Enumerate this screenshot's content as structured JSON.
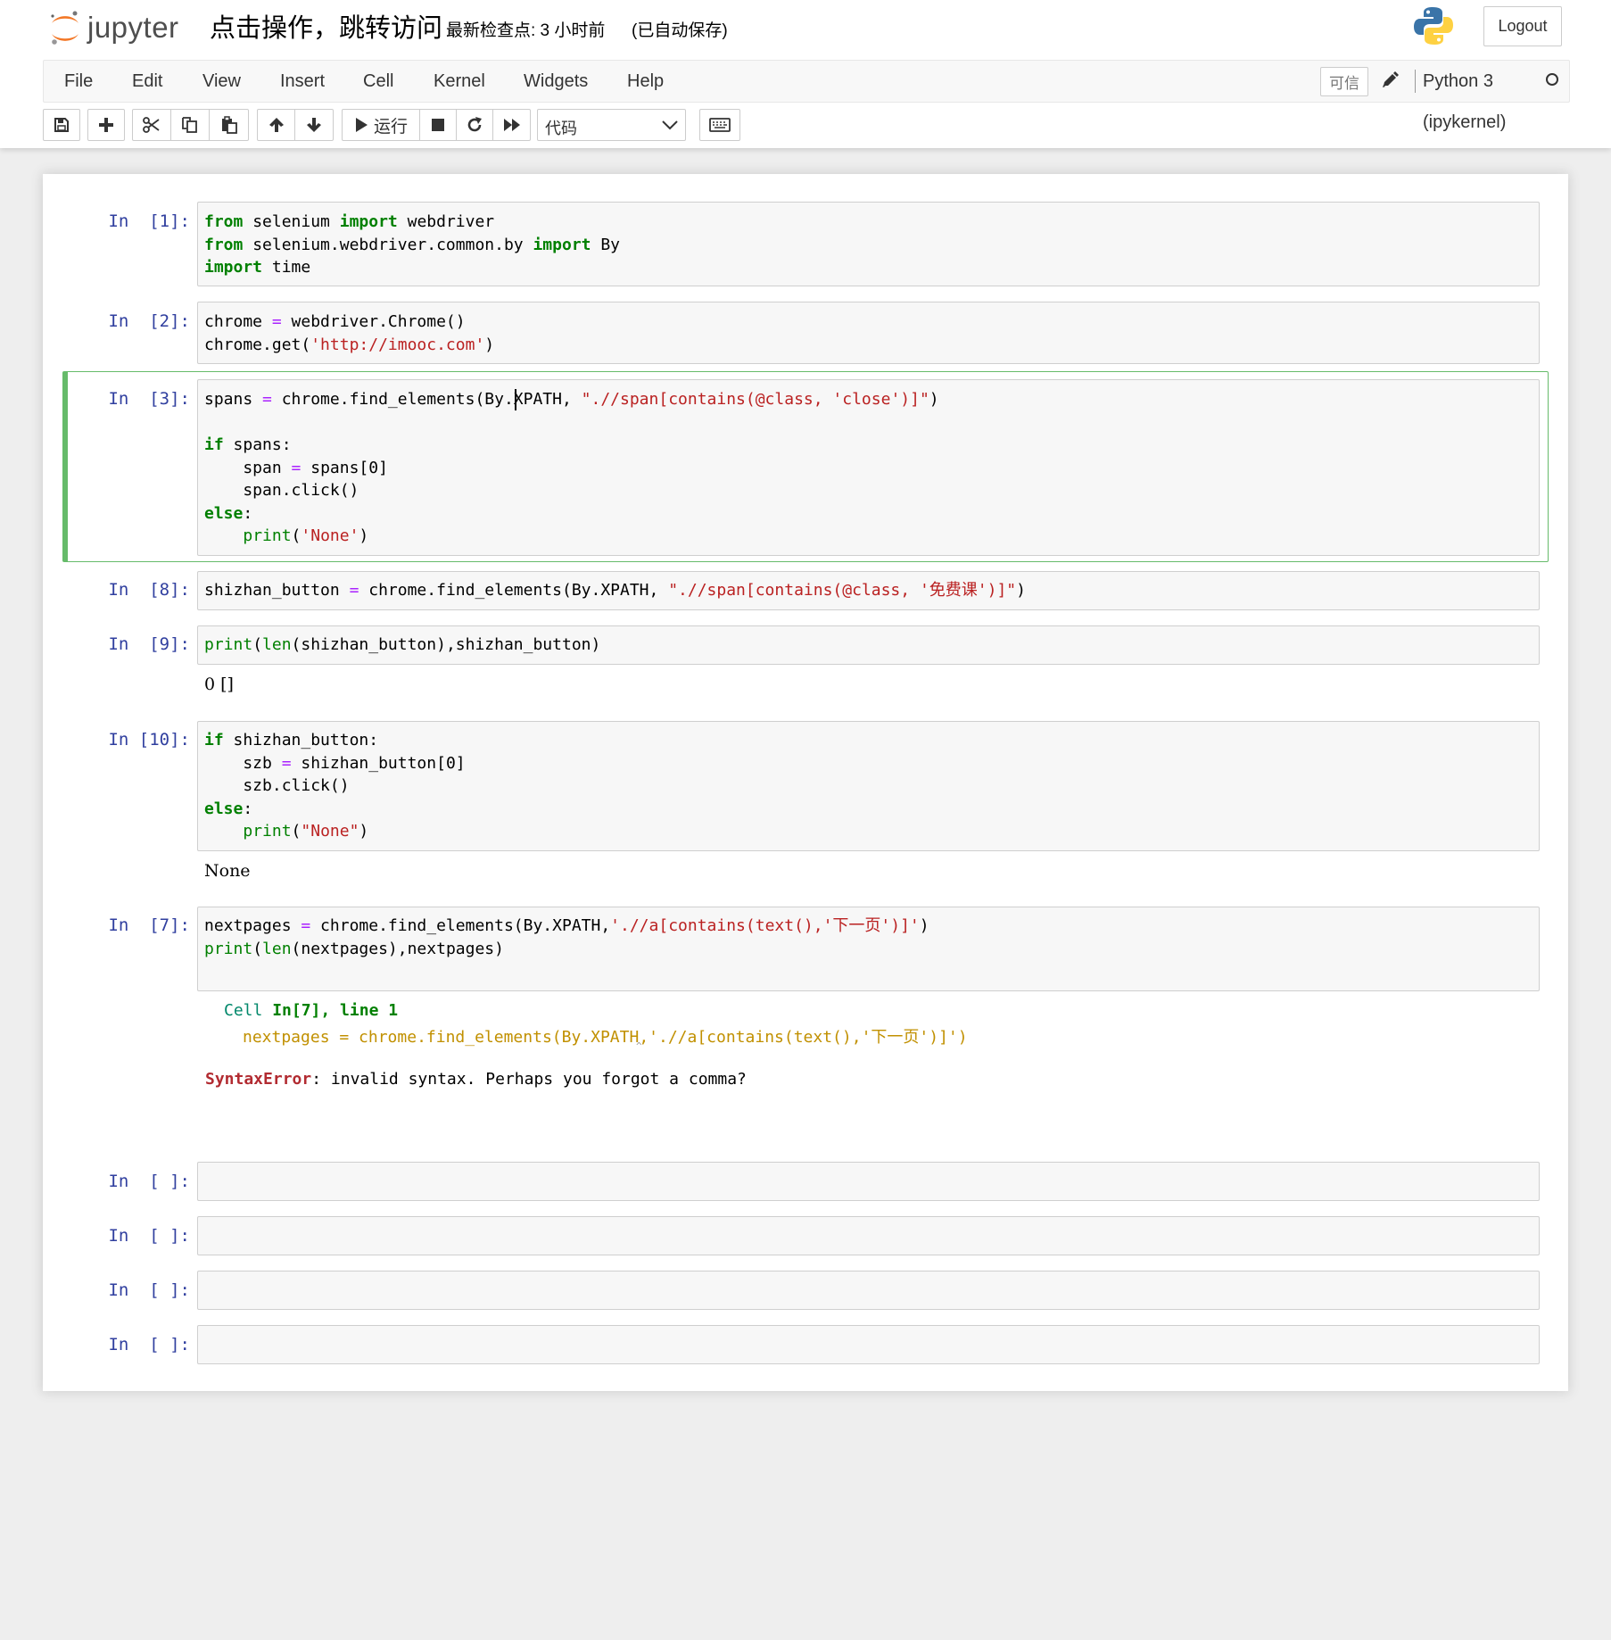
{
  "header": {
    "logo_text": "jupyter",
    "notebook_title": "点击操作，跳转访问",
    "checkpoint": "最新检查点: 3 小时前",
    "autosave": "(已自动保存)",
    "logout_label": "Logout"
  },
  "menubar": {
    "items": [
      "File",
      "Edit",
      "View",
      "Insert",
      "Cell",
      "Kernel",
      "Widgets",
      "Help"
    ],
    "trusted_label": "可信",
    "kernel_name": "Python 3 (ipykernel)"
  },
  "toolbar": {
    "run_label": "运行",
    "cell_type": "代码",
    "icons": [
      "save-icon",
      "plus-icon",
      "scissors-icon",
      "copy-icon",
      "paste-icon",
      "arrow-up-icon",
      "arrow-down-icon",
      "play-icon",
      "stop-icon",
      "restart-icon",
      "fast-forward-icon",
      "keyboard-icon"
    ]
  },
  "cells": [
    {
      "prompt": "In  [1]:",
      "lines": [
        [
          [
            "kw",
            "from"
          ],
          [
            "",
            " selenium "
          ],
          [
            "kw",
            "import"
          ],
          [
            "",
            " webdriver"
          ]
        ],
        [
          [
            "kw",
            "from"
          ],
          [
            "",
            " selenium.webdriver.common.by "
          ],
          [
            "kw",
            "import"
          ],
          [
            "",
            " By"
          ]
        ],
        [
          [
            "kw",
            "import"
          ],
          [
            "",
            " time"
          ]
        ]
      ]
    },
    {
      "prompt": "In  [2]:",
      "lines": [
        [
          [
            "",
            "chrome "
          ],
          [
            "op",
            "="
          ],
          [
            "",
            " webdriver.Chrome()"
          ]
        ],
        [
          [
            "",
            "chrome.get("
          ],
          [
            "str",
            "'http://imooc.com'"
          ],
          [
            "",
            ")"
          ]
        ]
      ]
    },
    {
      "prompt": "In  [3]:",
      "lines": [
        [
          [
            "",
            "spans "
          ],
          [
            "op",
            "="
          ],
          [
            "",
            " chrome.find_elements(By.XPATH, "
          ],
          [
            "str",
            "\".//span[contains(@class, 'close')]\""
          ],
          [
            "",
            ")"
          ]
        ],
        [],
        [
          [
            "kw",
            "if"
          ],
          [
            "",
            " spans:"
          ]
        ],
        [
          [
            "",
            "    span "
          ],
          [
            "op",
            "="
          ],
          [
            "",
            " spans[0]"
          ]
        ],
        [
          [
            "",
            "    span.click()"
          ]
        ],
        [
          [
            "kw",
            "else"
          ],
          [
            "",
            ":"
          ]
        ],
        [
          [
            "",
            "    "
          ],
          [
            "bi",
            "print"
          ],
          [
            "",
            "("
          ],
          [
            "str",
            "'None'"
          ],
          [
            "",
            ")"
          ]
        ]
      ]
    },
    {
      "prompt": "In  [8]:",
      "lines": [
        [
          [
            "",
            "shizhan_button "
          ],
          [
            "op",
            "="
          ],
          [
            "",
            " chrome.find_elements(By.XPATH, "
          ],
          [
            "str",
            "\".//span[contains(@class, '免费课')]\""
          ],
          [
            "",
            ")"
          ]
        ]
      ]
    },
    {
      "prompt": "In  [9]:",
      "lines": [
        [
          [
            "bi",
            "print"
          ],
          [
            "",
            "("
          ],
          [
            "bi",
            "len"
          ],
          [
            "",
            "(shizhan_button),shizhan_button)"
          ]
        ]
      ],
      "output": "0 []"
    },
    {
      "prompt": "In [10]:",
      "lines": [
        [
          [
            "kw",
            "if"
          ],
          [
            "",
            " shizhan_button:"
          ]
        ],
        [
          [
            "",
            "    szb "
          ],
          [
            "op",
            "="
          ],
          [
            "",
            " shizhan_button[0]"
          ]
        ],
        [
          [
            "",
            "    szb.click()"
          ]
        ],
        [
          [
            "kw",
            "else"
          ],
          [
            "",
            ":"
          ]
        ],
        [
          [
            "",
            "    "
          ],
          [
            "bi",
            "print"
          ],
          [
            "",
            "("
          ],
          [
            "str",
            "\"None\""
          ],
          [
            "",
            ")"
          ]
        ]
      ],
      "output": "None"
    },
    {
      "prompt": "In  [7]:",
      "lines": [
        [
          [
            "",
            "nextpages "
          ],
          [
            "op",
            "="
          ],
          [
            "",
            " chrome.find_elements(By.XPATH,"
          ],
          [
            "str",
            "'.//a[contains(text(),'下一页')]'"
          ],
          [
            "",
            ")"
          ]
        ],
        [
          [
            "bi",
            "print"
          ],
          [
            "",
            "("
          ],
          [
            "bi",
            "len"
          ],
          [
            "",
            "(nextpages),nextpages)"
          ]
        ]
      ],
      "error": {
        "location_prefix": "Cell",
        "location_cell": "In[7], line 1",
        "code_line": "nextpages = chrome.find_elements(By.XPATH,'.//a[contains(text(),'下一页')]')",
        "caret": "^",
        "error_name": "SyntaxError",
        "error_message": ": invalid syntax. Perhaps you forgot a comma?"
      }
    }
  ],
  "empty_prompts": [
    "In  [ ]:",
    "In  [ ]:",
    "In  [ ]:",
    "In  [ ]:"
  ],
  "colors": {
    "keyword": "#008000",
    "operator": "#aa22ff",
    "string": "#ba2121",
    "prompt": "#303f9f",
    "selected_border": "#66bb6a",
    "error_name": "#b22b31"
  }
}
